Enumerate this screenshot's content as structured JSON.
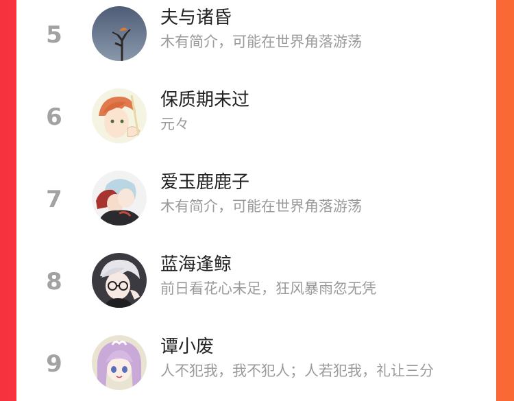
{
  "ranking": [
    {
      "rank": "5",
      "name": "夫与诸昏",
      "bio": "木有简介，可能在世界角落游荡",
      "avatar_icon": "branch-bird-avatar"
    },
    {
      "rank": "6",
      "name": "保质期未过",
      "bio": "元々",
      "avatar_icon": "anime-redhead-avatar"
    },
    {
      "rank": "7",
      "name": "爱玉鹿鹿子",
      "bio": "木有简介，可能在世界角落游荡",
      "avatar_icon": "anime-couple-avatar"
    },
    {
      "rank": "8",
      "name": "蓝海逢鲸",
      "bio": "前日看花心未足，狂风暴雨忽无凭",
      "avatar_icon": "anime-glasses-avatar"
    },
    {
      "rank": "9",
      "name": "谭小废",
      "bio": "人不犯我，我不犯人；人若犯我，礼让三分",
      "avatar_icon": "anime-purple-hair-avatar"
    }
  ],
  "colors": {
    "background_left": "#f6323f",
    "background_right": "#f96a35",
    "rank_text": "#a2a2a2",
    "name_text": "#222222",
    "bio_text": "#9a9a9a"
  }
}
